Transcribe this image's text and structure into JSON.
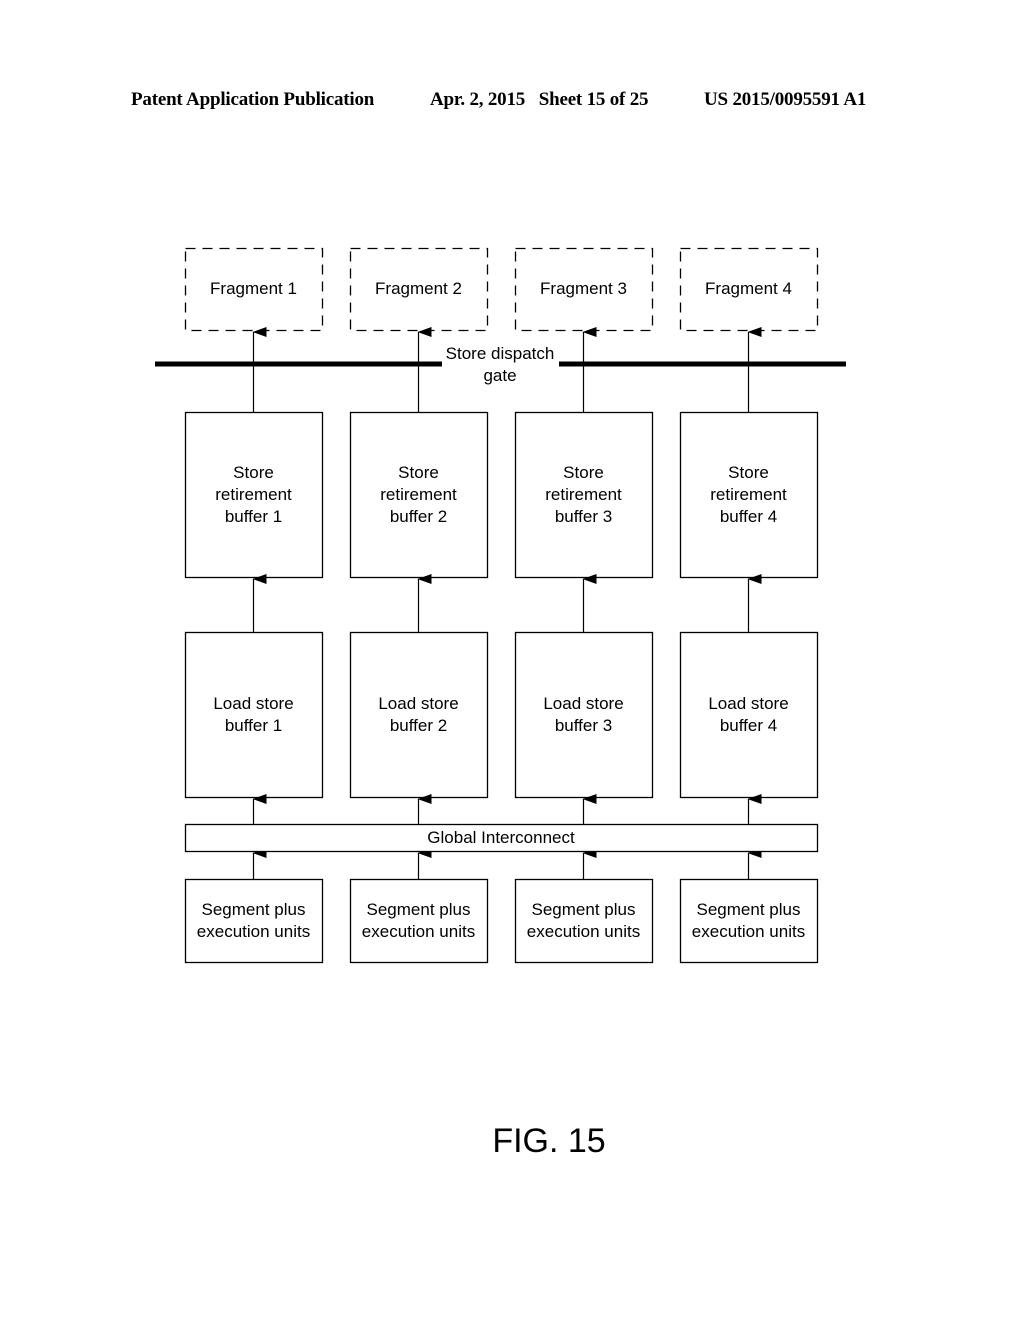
{
  "header": {
    "publication": "Patent Application Publication",
    "date_sheet": "Apr. 2, 2015   Sheet 15 of 25",
    "number": "US 2015/0095591 A1"
  },
  "diagram": {
    "fragments": [
      "Fragment 1",
      "Fragment 2",
      "Fragment 3",
      "Fragment 4"
    ],
    "gate_label": [
      "Store dispatch",
      "gate"
    ],
    "store_retirement_buffers": [
      [
        "Store",
        "retirement",
        "buffer 1"
      ],
      [
        "Store",
        "retirement",
        "buffer 2"
      ],
      [
        "Store",
        "retirement",
        "buffer 3"
      ],
      [
        "Store",
        "retirement",
        "buffer 4"
      ]
    ],
    "load_store_buffers": [
      [
        "Load store",
        "buffer 1"
      ],
      [
        "Load store",
        "buffer 2"
      ],
      [
        "Load store",
        "buffer 3"
      ],
      [
        "Load store",
        "buffer 4"
      ]
    ],
    "interconnect_label": "Global Interconnect",
    "segments": [
      [
        "Segment plus",
        "execution units"
      ],
      [
        "Segment plus",
        "execution units"
      ],
      [
        "Segment plus",
        "execution units"
      ],
      [
        "Segment plus",
        "execution units"
      ]
    ]
  },
  "figure_label": "FIG. 15"
}
